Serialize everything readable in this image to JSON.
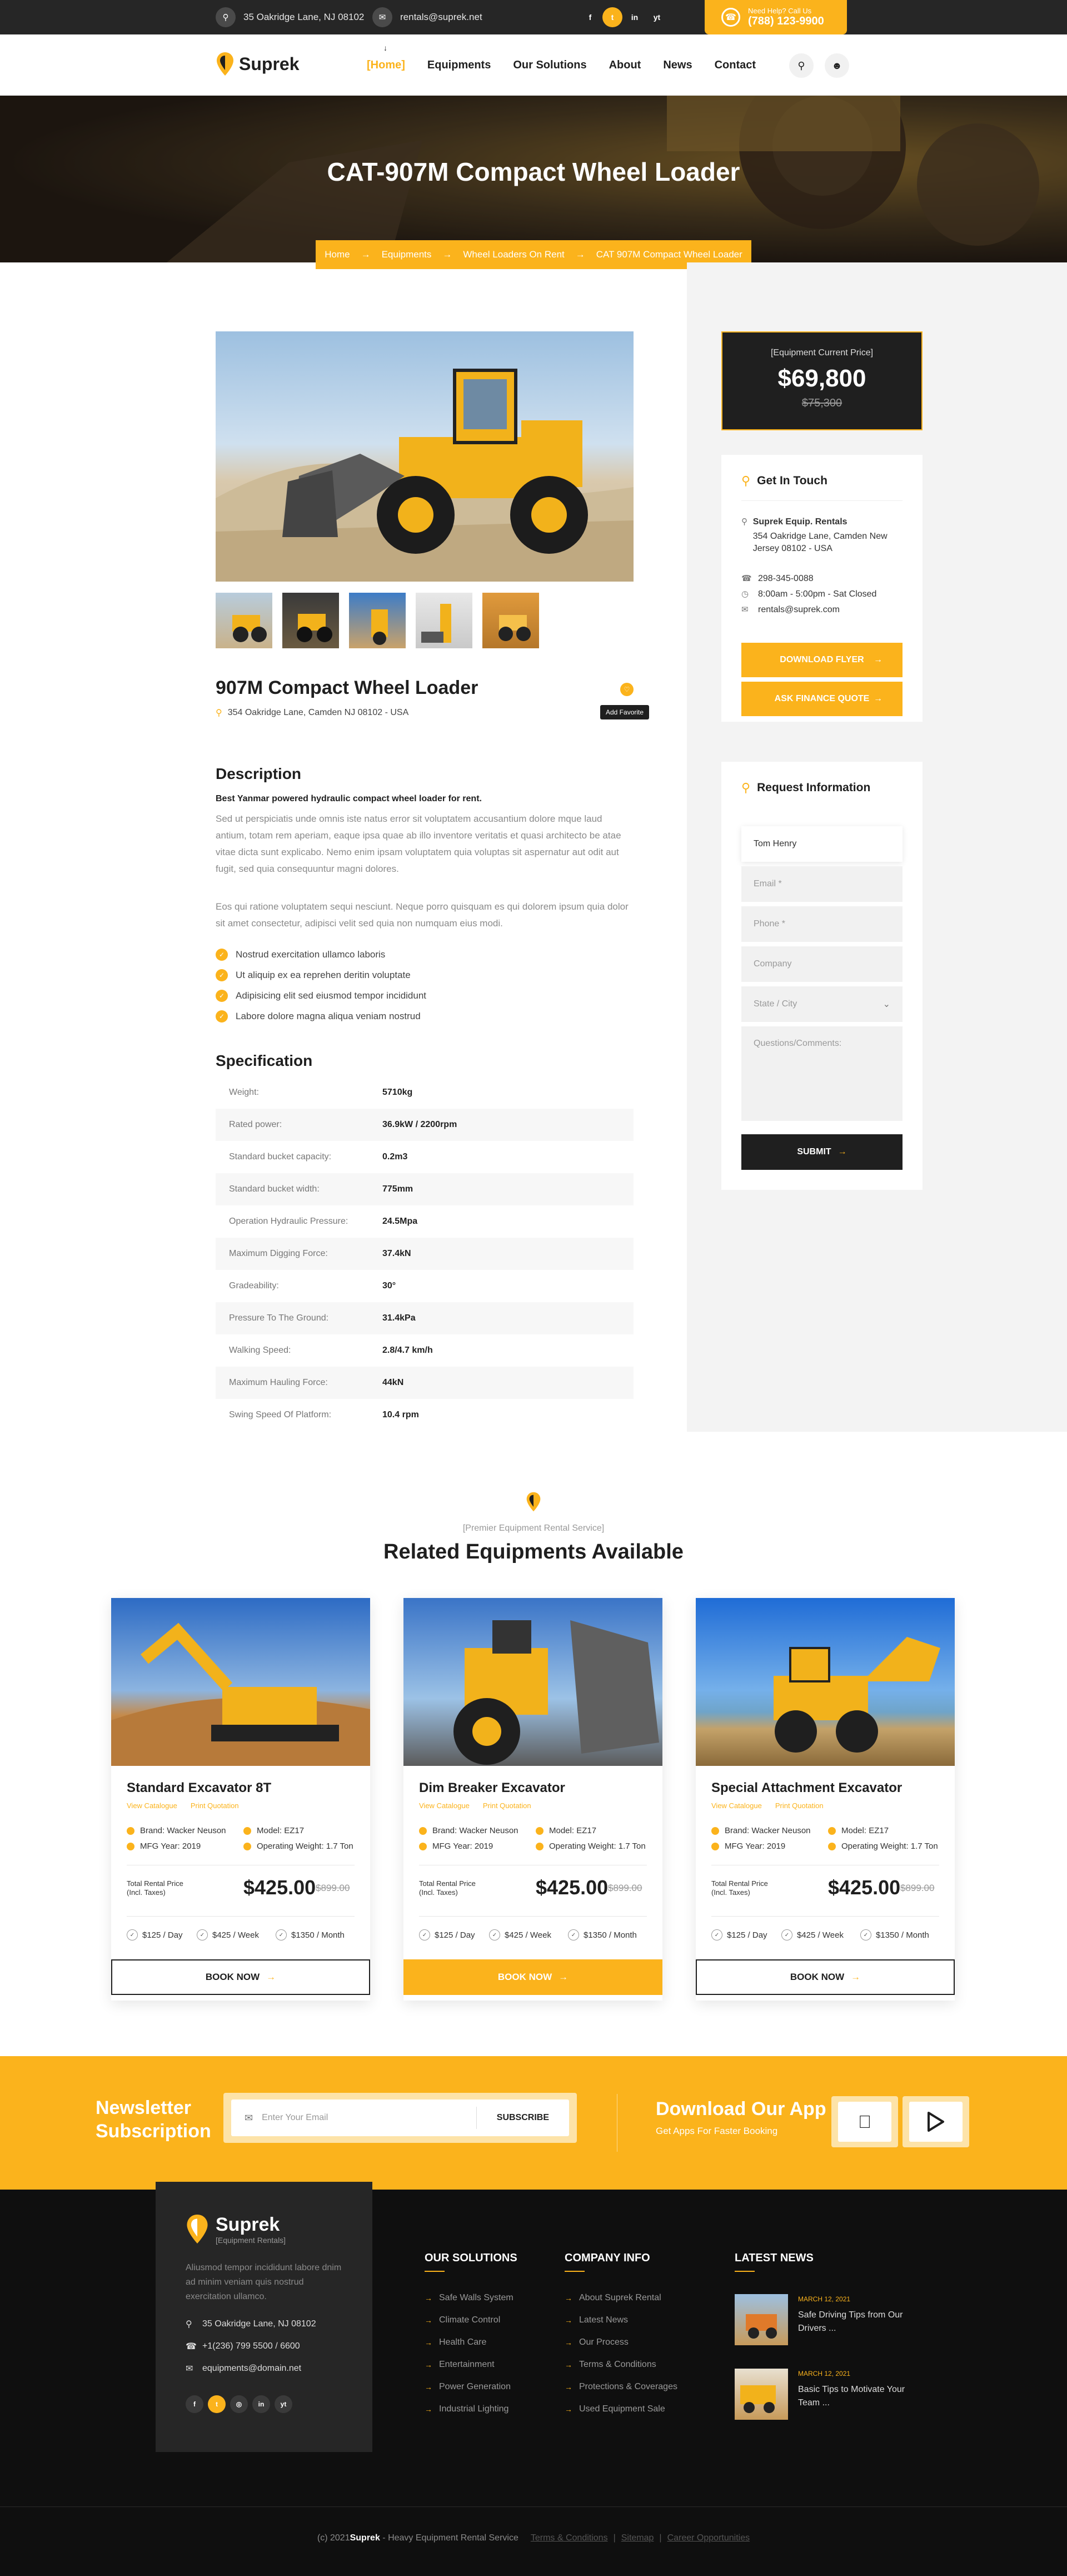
{
  "topbar": {
    "address": "35 Oakridge Lane, NJ 08102",
    "email": "rentals@suprek.net",
    "social": [
      "f",
      "t",
      "in",
      "yt"
    ],
    "call_label": "Need Help? Call Us",
    "call_number": "(788) 123-9900"
  },
  "header": {
    "logo": "Suprek",
    "nav": [
      "[Home]",
      "Equipments",
      "Our Solutions",
      "About",
      "News",
      "Contact"
    ]
  },
  "hero": {
    "title": "CAT-907M Compact Wheel Loader",
    "breadcrumb": [
      "Home",
      "Equipments",
      "Wheel Loaders On Rent",
      "CAT 907M Compact Wheel Loader"
    ]
  },
  "product": {
    "title": "907M Compact Wheel Loader",
    "address": "354 Oakridge Lane, Camden NJ 08102 - USA",
    "favorite_tooltip": "Add Favorite"
  },
  "description": {
    "heading": "Description",
    "lead": "Best Yanmar powered hydraulic compact wheel loader for rent.",
    "para1": "Sed ut perspiciatis unde omnis iste natus error sit voluptatem accusantium dolore mque laud antium, totam rem aperiam, eaque ipsa quae ab illo inventore veritatis et quasi architecto be atae vitae dicta sunt explicabo. Nemo enim ipsam voluptatem quia voluptas sit aspernatur aut odit aut fugit, sed quia consequuntur magni dolores.",
    "para2": "Eos qui ratione voluptatem sequi nesciunt. Neque porro quisquam es qui dolorem ipsum quia dolor sit amet consectetur, adipisci velit sed quia non numquam eius modi.",
    "bullets": [
      "Nostrud exercitation ullamco laboris",
      "Ut aliquip ex ea reprehen deritin voluptate",
      "Adipisicing elit sed eiusmod tempor incididunt",
      "Labore dolore magna aliqua veniam nostrud"
    ]
  },
  "specification": {
    "heading": "Specification",
    "rows": [
      {
        "k": "Weight:",
        "v": "5710kg"
      },
      {
        "k": "Rated power:",
        "v": "36.9kW / 2200rpm"
      },
      {
        "k": "Standard bucket capacity:",
        "v": "0.2m3"
      },
      {
        "k": "Standard bucket width:",
        "v": "775mm"
      },
      {
        "k": "Operation Hydraulic Pressure:",
        "v": "24.5Mpa"
      },
      {
        "k": "Maximum Digging Force:",
        "v": "37.4kN"
      },
      {
        "k": "Gradeability:",
        "v": "30°"
      },
      {
        "k": "Pressure To The Ground:",
        "v": "31.4kPa"
      },
      {
        "k": "Walking Speed:",
        "v": "2.8/4.7 km/h"
      },
      {
        "k": "Maximum Hauling Force:",
        "v": "44kN"
      },
      {
        "k": "Swing Speed Of Platform:",
        "v": "10.4 rpm"
      }
    ]
  },
  "price_box": {
    "label": "[Equipment Current Price]",
    "price": "$69,800",
    "old_price": "$75,300"
  },
  "get_in_touch": {
    "heading": "Get In Touch",
    "company": "Suprek Equip. Rentals",
    "address": "354 Oakridge Lane, Camden New Jersey 08102 - USA",
    "phone": "298-345-0088",
    "hours": "8:00am - 5:00pm - Sat Closed",
    "email": "rentals@suprek.com",
    "btn_flyer": "DOWNLOAD FLYER",
    "btn_quote": "ASK FINANCE QUOTE"
  },
  "request_form": {
    "heading": "Request Information",
    "name_value": "Tom Henry",
    "email_ph": "Email *",
    "phone_ph": "Phone *",
    "company_ph": "Company",
    "state_ph": "State / City",
    "comments_ph": "Questions/Comments:",
    "submit": "SUBMIT"
  },
  "related": {
    "tag": "[Premier Equipment Rental Service]",
    "heading": "Related Equipments Available",
    "cards": [
      {
        "title": "Standard Excavator 8T",
        "link1": "View Catalogue",
        "link2": "Print Quotation",
        "brand": "Brand: Wacker Neuson",
        "model": "Model: EZ17",
        "mfg": "MFG Year: 2019",
        "weight": "Operating Weight: 1.7 Ton",
        "trp1": "Total Rental Price",
        "trp2": "(Incl. Taxes)",
        "price": "$425.00",
        "old": "$899.00",
        "day": "$125 / Day",
        "week": "$425 / Week",
        "month": "$1350 / Month",
        "book": "BOOK NOW"
      },
      {
        "title": "Dim Breaker Excavator",
        "link1": "View Catalogue",
        "link2": "Print Quotation",
        "brand": "Brand: Wacker Neuson",
        "model": "Model: EZ17",
        "mfg": "MFG Year: 2019",
        "weight": "Operating Weight: 1.7 Ton",
        "trp1": "Total Rental Price",
        "trp2": "(Incl. Taxes)",
        "price": "$425.00",
        "old": "$899.00",
        "day": "$125 / Day",
        "week": "$425 / Week",
        "month": "$1350 / Month",
        "book": "BOOK NOW"
      },
      {
        "title": "Special Attachment Excavator",
        "link1": "View Catalogue",
        "link2": "Print Quotation",
        "brand": "Brand: Wacker Neuson",
        "model": "Model: EZ17",
        "mfg": "MFG Year: 2019",
        "weight": "Operating Weight: 1.7 Ton",
        "trp1": "Total Rental Price",
        "trp2": "(Incl. Taxes)",
        "price": "$425.00",
        "old": "$899.00",
        "day": "$125 / Day",
        "week": "$425 / Week",
        "month": "$1350 / Month",
        "book": "BOOK NOW"
      }
    ]
  },
  "newsletter": {
    "title1": "Newsletter",
    "title2": "Subscription",
    "placeholder": "Enter Your Email",
    "subscribe": "SUBSCRIBE",
    "app_title": "Download Our App",
    "app_sub": "Get Apps For Faster Booking"
  },
  "footer": {
    "logo": "Suprek",
    "logo_sub": "[Equipment Rentals]",
    "about": "Aliusmod tempor incididunt labore dnim ad minim veniam quis nostrud exercitation ullamco.",
    "address": "35 Oakridge Lane, NJ 08102",
    "phone": "+1(236) 799 5500 / 6600",
    "email": "equipments@domain.net",
    "solutions_h": "OUR SOLUTIONS",
    "solutions": [
      "Safe Walls System",
      "Climate Control",
      "Health Care",
      "Entertainment",
      "Power Generation",
      "Industrial Lighting"
    ],
    "company_h": "COMPANY INFO",
    "company": [
      "About Suprek Rental",
      "Latest News",
      "Our Process",
      "Terms & Conditions",
      "Protections & Coverages",
      "Used Equipment Sale"
    ],
    "news_h": "LATEST NEWS",
    "news": [
      {
        "date": "MARCH 12, 2021",
        "title": "Safe Driving Tips from Our Drivers ..."
      },
      {
        "date": "MARCH 12, 2021",
        "title": "Basic Tips to Motivate Your Team ..."
      }
    ],
    "copy_prefix": "(c) 2021 ",
    "copy_brand": "Suprek",
    "copy_suffix": " - Heavy Equipment Rental Service",
    "bottom_links": [
      "Terms & Conditions",
      "Sitemap",
      "Career Opportunities"
    ]
  },
  "colors": {
    "accent": "#fbb31c",
    "dark": "#262626",
    "footer": "#0f0f0f"
  }
}
